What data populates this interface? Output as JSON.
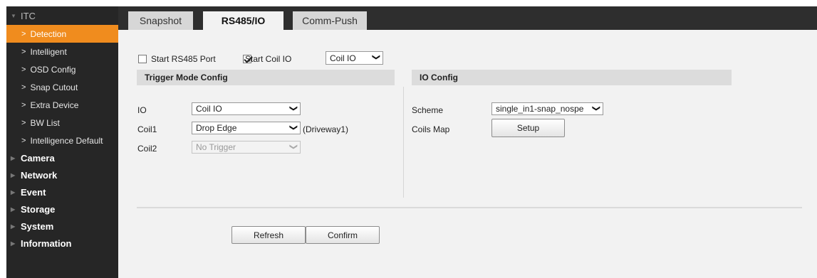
{
  "sidebar": {
    "itc_label": "ITC",
    "items": [
      {
        "label": "Detection"
      },
      {
        "label": "Intelligent"
      },
      {
        "label": "OSD Config"
      },
      {
        "label": "Snap Cutout"
      },
      {
        "label": "Extra Device"
      },
      {
        "label": "BW List"
      },
      {
        "label": "Intelligence Default"
      }
    ],
    "sections": [
      "Camera",
      "Network",
      "Event",
      "Storage",
      "System",
      "Information"
    ]
  },
  "tabs": [
    {
      "label": "Snapshot"
    },
    {
      "label": "RS485/IO"
    },
    {
      "label": "Comm-Push"
    }
  ],
  "top_options": {
    "start_rs485_label": "Start RS485 Port",
    "start_rs485_checked": false,
    "start_coil_io_label": "Start Coil IO",
    "start_coil_io_checked": true,
    "mode_select_value": "Coil IO"
  },
  "trigger_panel": {
    "title": "Trigger Mode Config",
    "io_label": "IO",
    "io_value": "Coil IO",
    "coil1_label": "Coil1",
    "coil1_value": "Drop Edge",
    "coil1_note": "(Driveway1)",
    "coil2_label": "Coil2",
    "coil2_value": "No Trigger"
  },
  "io_panel": {
    "title": "IO Config",
    "scheme_label": "Scheme",
    "scheme_value": "single_in1-snap_nospe",
    "coils_map_label": "Coils Map",
    "setup_button": "Setup"
  },
  "actions": {
    "refresh": "Refresh",
    "confirm": "Confirm"
  },
  "colors": {
    "sidebar_bg": "#262626",
    "active_item": "#f08c1e",
    "content_bg": "#f2f2f2"
  }
}
